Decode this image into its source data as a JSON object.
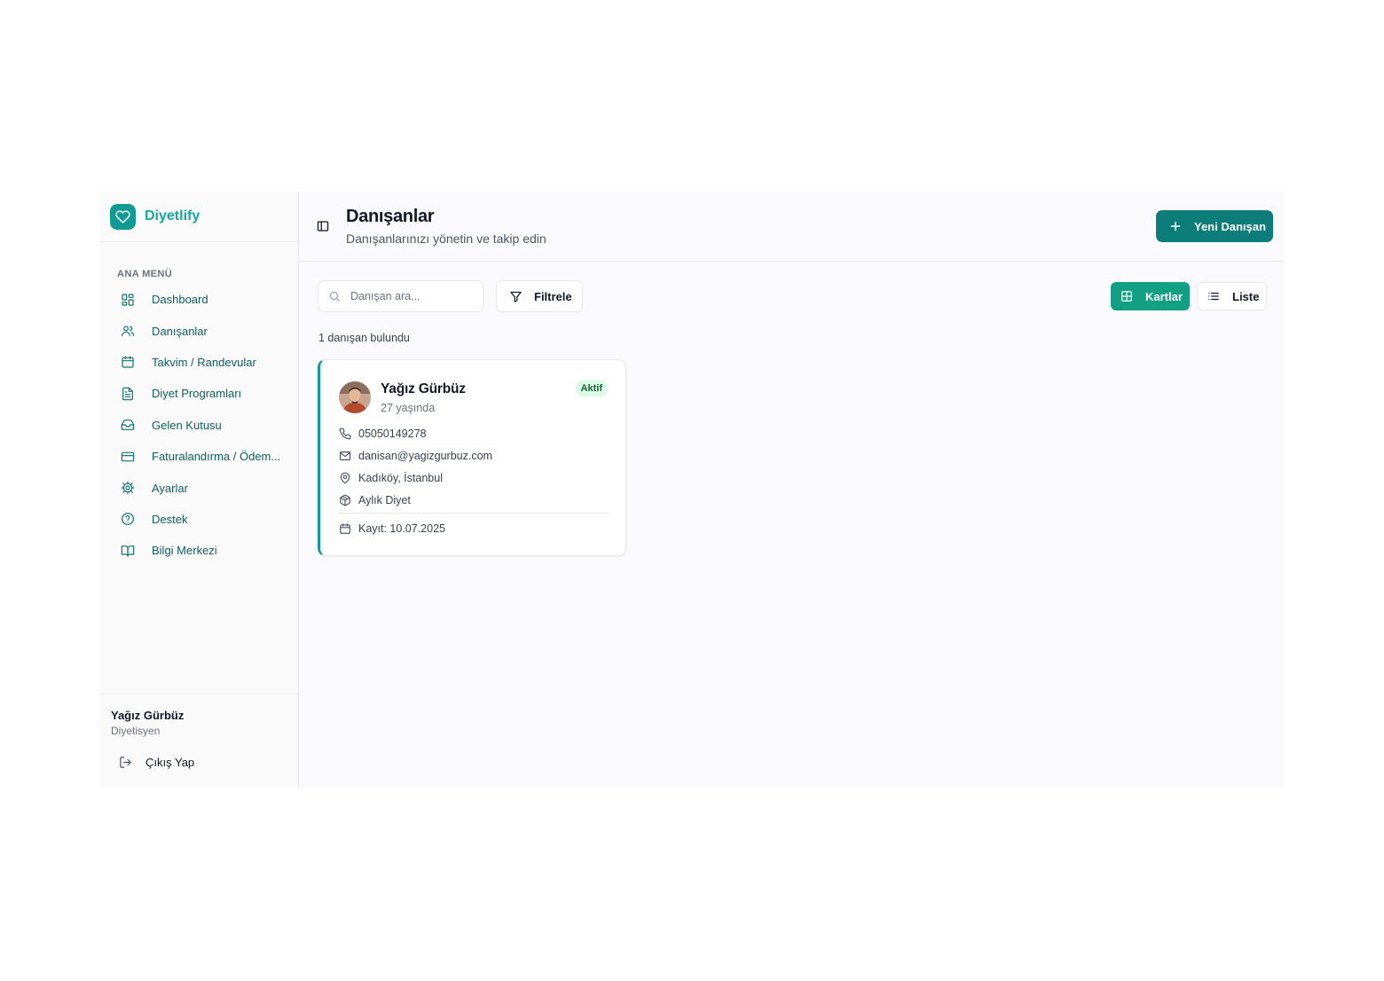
{
  "brand": {
    "name": "Diyetlify",
    "accent": "#0f9b94"
  },
  "sidebar": {
    "menu_title": "ANA MENÜ",
    "items": [
      {
        "label": "Dashboard",
        "icon": "dashboard-grid-icon"
      },
      {
        "label": "Danışanlar",
        "icon": "users-icon"
      },
      {
        "label": "Takvim / Randevular",
        "icon": "calendar-icon"
      },
      {
        "label": "Diyet Programları",
        "icon": "document-icon"
      },
      {
        "label": "Gelen Kutusu",
        "icon": "inbox-icon"
      },
      {
        "label": "Faturalandırma / Ödem...",
        "icon": "credit-card-icon"
      },
      {
        "label": "Ayarlar",
        "icon": "settings-gear-icon"
      },
      {
        "label": "Destek",
        "icon": "help-circle-icon"
      },
      {
        "label": "Bilgi Merkezi",
        "icon": "book-open-icon"
      }
    ],
    "user": {
      "name": "Yağız Gürbüz",
      "role": "Diyetisyen"
    },
    "logout_label": "Çıkış Yap"
  },
  "header": {
    "title": "Danışanlar",
    "subtitle": "Danışanlarınızı yönetin ve takip edin",
    "new_button_label": "Yeni Danışan",
    "new_button_color": "#0c7d79"
  },
  "toolbar": {
    "search_placeholder": "Danışan ara...",
    "search_value": "",
    "filter_label": "Filtrele",
    "view_cards_label": "Kartlar",
    "view_list_label": "Liste",
    "active_view": "Kartlar",
    "active_view_color": "#12a085"
  },
  "results": {
    "count_text": "1 danışan bulundu"
  },
  "clients": [
    {
      "name": "Yağız Gürbüz",
      "age": "27 yaşında",
      "status": "Aktif",
      "status_color": "#dcfce7",
      "phone": "05050149278",
      "email": "danisan@yagizgurbuz.com",
      "location": "Kadıköy, İstanbul",
      "program": "Aylık Diyet",
      "registered": "Kayıt: 10.07.2025"
    }
  ]
}
